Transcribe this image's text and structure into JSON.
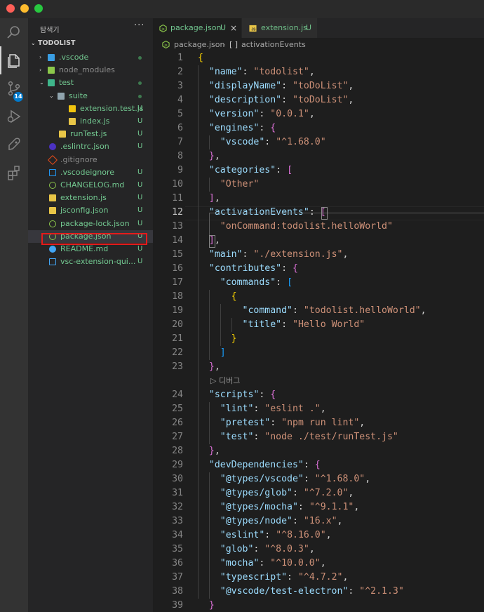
{
  "colors": {
    "editor_bg": "#1e1e1e",
    "sidebar_bg": "#252526",
    "activity_bg": "#333333",
    "git_untracked": "#73c991",
    "json_key": "#9cdcfe",
    "json_string": "#ce9178",
    "bracket_gold": "#ffd700",
    "bracket_purple": "#da70d6",
    "bracket_blue": "#179fff",
    "highlight_box": "#e51b1b"
  },
  "activity_bar": {
    "items": [
      {
        "icon": "explorer-icon",
        "active": true
      },
      {
        "icon": "search-icon"
      },
      {
        "icon": "source-control-icon",
        "badge": "14"
      },
      {
        "icon": "run-debug-icon"
      },
      {
        "icon": "remote-explorer-icon"
      },
      {
        "icon": "extensions-icon"
      }
    ]
  },
  "sidebar": {
    "title": "탐색기",
    "more": "···",
    "section_title": "TODOLIST",
    "tree": [
      {
        "label": ".vscode",
        "chev": "›",
        "icon": "vscode-folder-icon",
        "status": "dot"
      },
      {
        "label": "node_modules",
        "chev": "›",
        "icon": "node-folder-icon",
        "status": ""
      },
      {
        "label": "test",
        "chev": "⌄",
        "icon": "test-folder-icon",
        "status": "dot"
      },
      {
        "label": "suite",
        "chev": "⌄",
        "icon": "folder-icon",
        "status": "dot"
      },
      {
        "label": "extension.test.js",
        "chev": "",
        "icon": "test-file-icon",
        "status": "U"
      },
      {
        "label": "index.js",
        "chev": "",
        "icon": "js-file-icon",
        "status": "U"
      },
      {
        "label": "runTest.js",
        "chev": "",
        "icon": "js-file-icon",
        "status": "U"
      },
      {
        "label": ".eslintrc.json",
        "chev": "",
        "icon": "eslint-icon",
        "status": "U"
      },
      {
        "label": ".gitignore",
        "chev": "",
        "icon": "git-icon",
        "status": ""
      },
      {
        "label": ".vscodeignore",
        "chev": "",
        "icon": "vscode-icon",
        "status": "U"
      },
      {
        "label": "CHANGELOG.md",
        "chev": "",
        "icon": "changelog-icon",
        "status": "U"
      },
      {
        "label": "extension.js",
        "chev": "",
        "icon": "js-file-icon",
        "status": "U"
      },
      {
        "label": "jsconfig.json",
        "chev": "",
        "icon": "jsconfig-icon",
        "status": "U"
      },
      {
        "label": "package-lock.json",
        "chev": "",
        "icon": "nodejs-icon",
        "status": "U"
      },
      {
        "label": "package.json",
        "chev": "",
        "icon": "nodejs-icon",
        "status": "U"
      },
      {
        "label": "README.md",
        "chev": "",
        "icon": "info-icon",
        "status": "U"
      },
      {
        "label": "vsc-extension-qui...",
        "chev": "",
        "icon": "markdown-icon",
        "status": "U"
      }
    ]
  },
  "tabs": [
    {
      "label": "package.json",
      "status": "U",
      "close": "×",
      "icon": "nodejs-icon",
      "active": true
    },
    {
      "label": "extension.js",
      "status": "U",
      "icon": "js-file-icon",
      "active": false
    }
  ],
  "breadcrumb": {
    "file": "package.json",
    "separator": "›",
    "symbol_icon": "[ ]",
    "symbol": "activationEvents"
  },
  "editor": {
    "current_line": "12",
    "codelens": "▷ 디버그",
    "lines": [
      {
        "n": "1",
        "t": [
          [
            "{",
            "b1"
          ]
        ]
      },
      {
        "n": "2",
        "t": [
          [
            "  ",
            "p"
          ],
          [
            "\"name\"",
            "k"
          ],
          [
            ": ",
            "p"
          ],
          [
            "\"todolist\"",
            "s"
          ],
          [
            ",",
            "p"
          ]
        ]
      },
      {
        "n": "3",
        "t": [
          [
            "  ",
            "p"
          ],
          [
            "\"displayName\"",
            "k"
          ],
          [
            ": ",
            "p"
          ],
          [
            "\"toDoList\"",
            "s"
          ],
          [
            ",",
            "p"
          ]
        ]
      },
      {
        "n": "4",
        "t": [
          [
            "  ",
            "p"
          ],
          [
            "\"description\"",
            "k"
          ],
          [
            ": ",
            "p"
          ],
          [
            "\"toDoList\"",
            "s"
          ],
          [
            ",",
            "p"
          ]
        ]
      },
      {
        "n": "5",
        "t": [
          [
            "  ",
            "p"
          ],
          [
            "\"version\"",
            "k"
          ],
          [
            ": ",
            "p"
          ],
          [
            "\"0.0.1\"",
            "s"
          ],
          [
            ",",
            "p"
          ]
        ]
      },
      {
        "n": "6",
        "t": [
          [
            "  ",
            "p"
          ],
          [
            "\"engines\"",
            "k"
          ],
          [
            ": ",
            "p"
          ],
          [
            "{",
            "b2"
          ]
        ]
      },
      {
        "n": "7",
        "t": [
          [
            "    ",
            "p"
          ],
          [
            "\"vscode\"",
            "k"
          ],
          [
            ": ",
            "p"
          ],
          [
            "\"^1.68.0\"",
            "s"
          ]
        ]
      },
      {
        "n": "8",
        "t": [
          [
            "  ",
            "p"
          ],
          [
            "}",
            "b2"
          ],
          [
            ",",
            "p"
          ]
        ]
      },
      {
        "n": "9",
        "t": [
          [
            "  ",
            "p"
          ],
          [
            "\"categories\"",
            "k"
          ],
          [
            ": ",
            "p"
          ],
          [
            "[",
            "b2"
          ]
        ]
      },
      {
        "n": "10",
        "t": [
          [
            "    ",
            "p"
          ],
          [
            "\"Other\"",
            "s"
          ]
        ]
      },
      {
        "n": "11",
        "t": [
          [
            "  ",
            "p"
          ],
          [
            "]",
            "b2"
          ],
          [
            ",",
            "p"
          ]
        ]
      },
      {
        "n": "12",
        "t": [
          [
            "  ",
            "p"
          ],
          [
            "\"activationEvents\"",
            "k"
          ],
          [
            ": ",
            "p"
          ],
          [
            "[",
            "b2"
          ]
        ]
      },
      {
        "n": "13",
        "t": [
          [
            "    ",
            "p"
          ],
          [
            "\"onCommand:todolist.helloWorld\"",
            "s"
          ]
        ]
      },
      {
        "n": "14",
        "t": [
          [
            "  ",
            "p"
          ],
          [
            "]",
            "b2"
          ],
          [
            ",",
            "p"
          ]
        ]
      },
      {
        "n": "15",
        "t": [
          [
            "  ",
            "p"
          ],
          [
            "\"main\"",
            "k"
          ],
          [
            ": ",
            "p"
          ],
          [
            "\"./extension.js\"",
            "s"
          ],
          [
            ",",
            "p"
          ]
        ]
      },
      {
        "n": "16",
        "t": [
          [
            "  ",
            "p"
          ],
          [
            "\"contributes\"",
            "k"
          ],
          [
            ": ",
            "p"
          ],
          [
            "{",
            "b2"
          ]
        ]
      },
      {
        "n": "17",
        "t": [
          [
            "    ",
            "p"
          ],
          [
            "\"commands\"",
            "k"
          ],
          [
            ": ",
            "p"
          ],
          [
            "[",
            "b3"
          ]
        ]
      },
      {
        "n": "18",
        "t": [
          [
            "      ",
            "p"
          ],
          [
            "{",
            "b1"
          ]
        ]
      },
      {
        "n": "19",
        "t": [
          [
            "        ",
            "p"
          ],
          [
            "\"command\"",
            "k"
          ],
          [
            ": ",
            "p"
          ],
          [
            "\"todolist.helloWorld\"",
            "s"
          ],
          [
            ",",
            "p"
          ]
        ]
      },
      {
        "n": "20",
        "t": [
          [
            "        ",
            "p"
          ],
          [
            "\"title\"",
            "k"
          ],
          [
            ": ",
            "p"
          ],
          [
            "\"Hello World\"",
            "s"
          ]
        ]
      },
      {
        "n": "21",
        "t": [
          [
            "      ",
            "p"
          ],
          [
            "}",
            "b1"
          ]
        ]
      },
      {
        "n": "22",
        "t": [
          [
            "    ",
            "p"
          ],
          [
            "]",
            "b3"
          ]
        ]
      },
      {
        "n": "23",
        "t": [
          [
            "  ",
            "p"
          ],
          [
            "}",
            "b2"
          ],
          [
            ",",
            "p"
          ]
        ]
      },
      {
        "lens": true
      },
      {
        "n": "24",
        "t": [
          [
            "  ",
            "p"
          ],
          [
            "\"scripts\"",
            "k"
          ],
          [
            ": ",
            "p"
          ],
          [
            "{",
            "b2"
          ]
        ]
      },
      {
        "n": "25",
        "t": [
          [
            "    ",
            "p"
          ],
          [
            "\"lint\"",
            "k"
          ],
          [
            ": ",
            "p"
          ],
          [
            "\"eslint .\"",
            "s"
          ],
          [
            ",",
            "p"
          ]
        ]
      },
      {
        "n": "26",
        "t": [
          [
            "    ",
            "p"
          ],
          [
            "\"pretest\"",
            "k"
          ],
          [
            ": ",
            "p"
          ],
          [
            "\"npm run lint\"",
            "s"
          ],
          [
            ",",
            "p"
          ]
        ]
      },
      {
        "n": "27",
        "t": [
          [
            "    ",
            "p"
          ],
          [
            "\"test\"",
            "k"
          ],
          [
            ": ",
            "p"
          ],
          [
            "\"node ./test/runTest.js\"",
            "s"
          ]
        ]
      },
      {
        "n": "28",
        "t": [
          [
            "  ",
            "p"
          ],
          [
            "}",
            "b2"
          ],
          [
            ",",
            "p"
          ]
        ]
      },
      {
        "n": "29",
        "t": [
          [
            "  ",
            "p"
          ],
          [
            "\"devDependencies\"",
            "k"
          ],
          [
            ": ",
            "p"
          ],
          [
            "{",
            "b2"
          ]
        ]
      },
      {
        "n": "30",
        "t": [
          [
            "    ",
            "p"
          ],
          [
            "\"@types/vscode\"",
            "k"
          ],
          [
            ": ",
            "p"
          ],
          [
            "\"^1.68.0\"",
            "s"
          ],
          [
            ",",
            "p"
          ]
        ]
      },
      {
        "n": "31",
        "t": [
          [
            "    ",
            "p"
          ],
          [
            "\"@types/glob\"",
            "k"
          ],
          [
            ": ",
            "p"
          ],
          [
            "\"^7.2.0\"",
            "s"
          ],
          [
            ",",
            "p"
          ]
        ]
      },
      {
        "n": "32",
        "t": [
          [
            "    ",
            "p"
          ],
          [
            "\"@types/mocha\"",
            "k"
          ],
          [
            ": ",
            "p"
          ],
          [
            "\"^9.1.1\"",
            "s"
          ],
          [
            ",",
            "p"
          ]
        ]
      },
      {
        "n": "33",
        "t": [
          [
            "    ",
            "p"
          ],
          [
            "\"@types/node\"",
            "k"
          ],
          [
            ": ",
            "p"
          ],
          [
            "\"16.x\"",
            "s"
          ],
          [
            ",",
            "p"
          ]
        ]
      },
      {
        "n": "34",
        "t": [
          [
            "    ",
            "p"
          ],
          [
            "\"eslint\"",
            "k"
          ],
          [
            ": ",
            "p"
          ],
          [
            "\"^8.16.0\"",
            "s"
          ],
          [
            ",",
            "p"
          ]
        ]
      },
      {
        "n": "35",
        "t": [
          [
            "    ",
            "p"
          ],
          [
            "\"glob\"",
            "k"
          ],
          [
            ": ",
            "p"
          ],
          [
            "\"^8.0.3\"",
            "s"
          ],
          [
            ",",
            "p"
          ]
        ]
      },
      {
        "n": "36",
        "t": [
          [
            "    ",
            "p"
          ],
          [
            "\"mocha\"",
            "k"
          ],
          [
            ": ",
            "p"
          ],
          [
            "\"^10.0.0\"",
            "s"
          ],
          [
            ",",
            "p"
          ]
        ]
      },
      {
        "n": "37",
        "t": [
          [
            "    ",
            "p"
          ],
          [
            "\"typescript\"",
            "k"
          ],
          [
            ": ",
            "p"
          ],
          [
            "\"^4.7.2\"",
            "s"
          ],
          [
            ",",
            "p"
          ]
        ]
      },
      {
        "n": "38",
        "t": [
          [
            "    ",
            "p"
          ],
          [
            "\"@vscode/test-electron\"",
            "k"
          ],
          [
            ": ",
            "p"
          ],
          [
            "\"^2.1.3\"",
            "s"
          ]
        ]
      },
      {
        "n": "39",
        "t": [
          [
            "  ",
            "p"
          ],
          [
            "}",
            "b2"
          ]
        ]
      }
    ]
  }
}
